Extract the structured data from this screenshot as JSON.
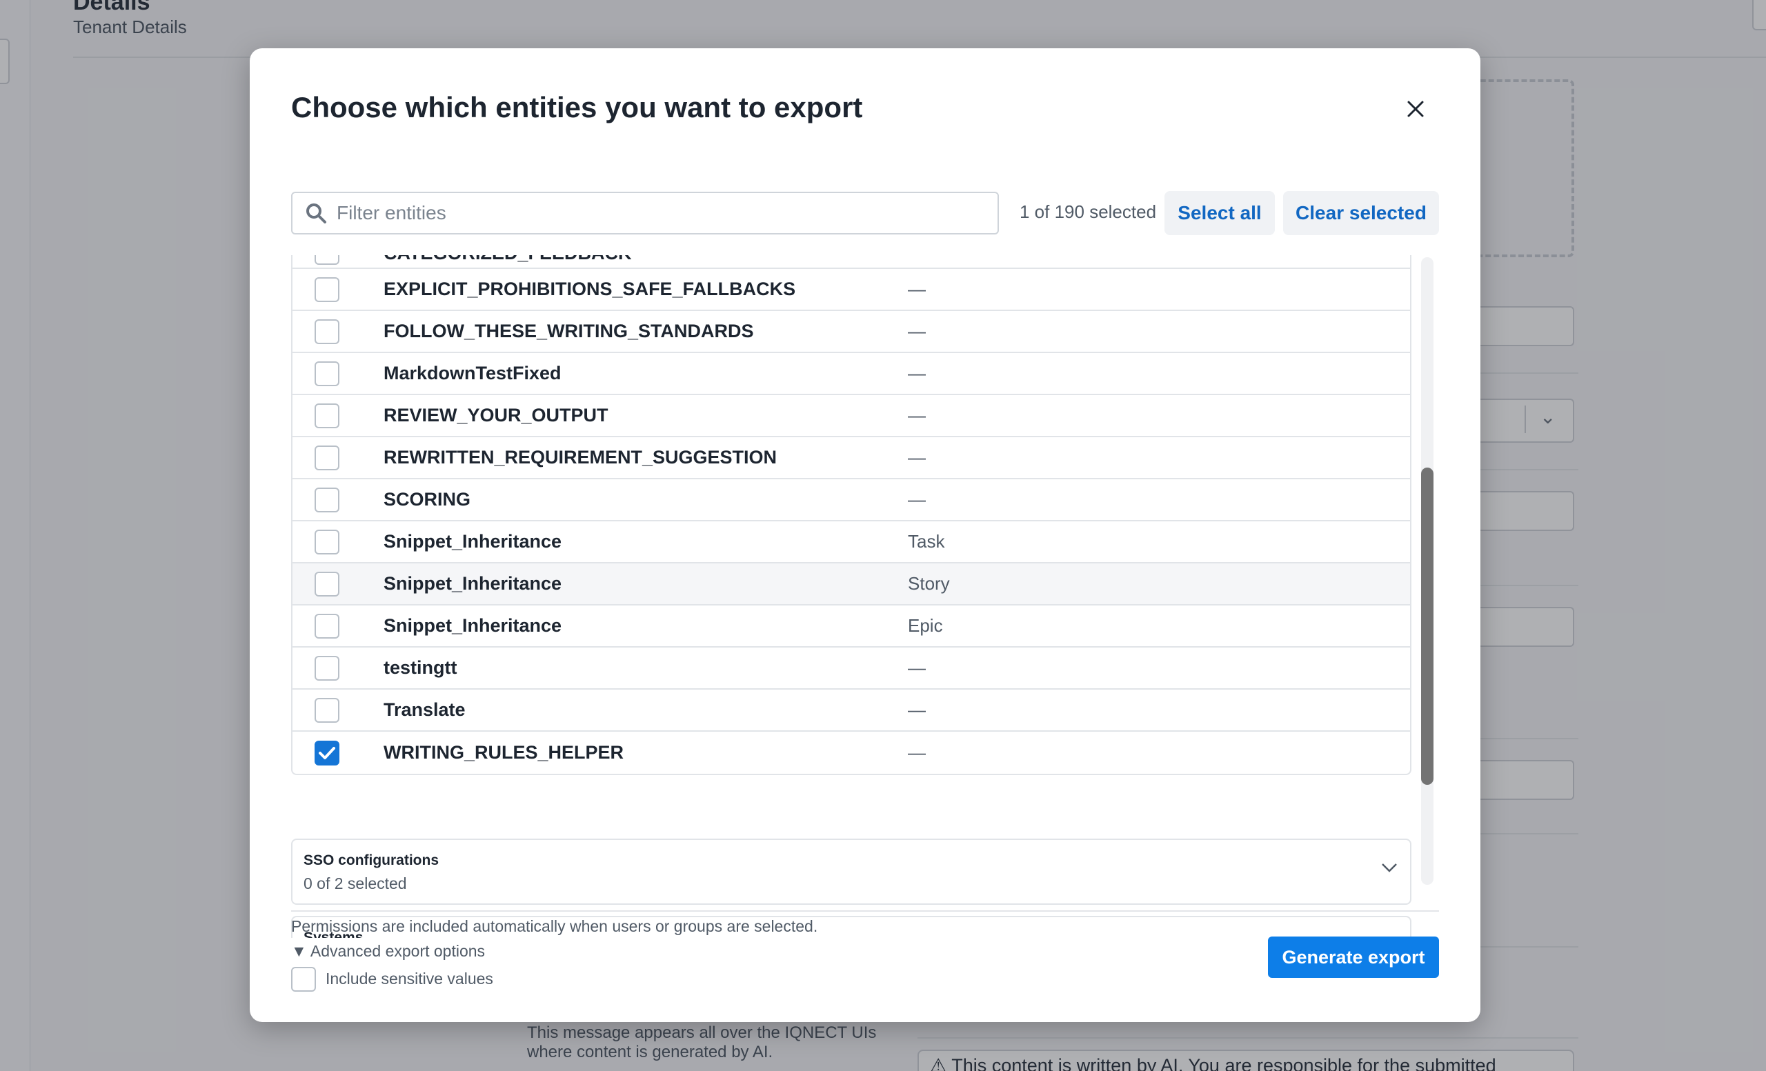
{
  "background": {
    "page_title": "Details",
    "page_subtitle": "Tenant Details",
    "ai_message": "This message appears all over the IQNECT UIs where content is generated by AI.",
    "ai_banner": "This content is written by AI. You are responsible for the submitted"
  },
  "modal": {
    "title": "Choose which entities you want to export",
    "close_icon": "close-icon",
    "search_placeholder": "Filter entities",
    "search_value": "",
    "selection_count": "1 of 190 selected",
    "select_all_label": "Select all",
    "clear_selected_label": "Clear selected",
    "partial_row_label": "CATEGORIZED_FEEDBACK",
    "rows": [
      {
        "name": "EXPLICIT_PROHIBITIONS_SAFE_FALLBACKS",
        "type": "—",
        "checked": false
      },
      {
        "name": "FOLLOW_THESE_WRITING_STANDARDS",
        "type": "—",
        "checked": false
      },
      {
        "name": "MarkdownTestFixed",
        "type": "—",
        "checked": false
      },
      {
        "name": "REVIEW_YOUR_OUTPUT",
        "type": "—",
        "checked": false
      },
      {
        "name": "REWRITTEN_REQUIREMENT_SUGGESTION",
        "type": "—",
        "checked": false
      },
      {
        "name": "SCORING",
        "type": "—",
        "checked": false
      },
      {
        "name": "Snippet_Inheritance",
        "type": "Task",
        "checked": false
      },
      {
        "name": "Snippet_Inheritance",
        "type": "Story",
        "checked": false
      },
      {
        "name": "Snippet_Inheritance",
        "type": "Epic",
        "checked": false
      },
      {
        "name": "testingtt",
        "type": "—",
        "checked": false
      },
      {
        "name": "Translate",
        "type": "—",
        "checked": false
      },
      {
        "name": "WRITING_RULES_HELPER",
        "type": "—",
        "checked": true
      }
    ],
    "groups": [
      {
        "title": "SSO configurations",
        "subtitle": "0 of 2 selected"
      },
      {
        "title": "Systems",
        "subtitle": ""
      }
    ],
    "permissions_note": "Permissions are included automatically when users or groups are selected.",
    "advanced_options_label": "▼ Advanced export options",
    "include_sensitive_label": "Include sensitive values",
    "include_sensitive_checked": false,
    "generate_label": "Generate export"
  },
  "colors": {
    "accent": "#0d7ee8",
    "link": "#1167c2",
    "checkbox_checked": "#1475d6"
  }
}
